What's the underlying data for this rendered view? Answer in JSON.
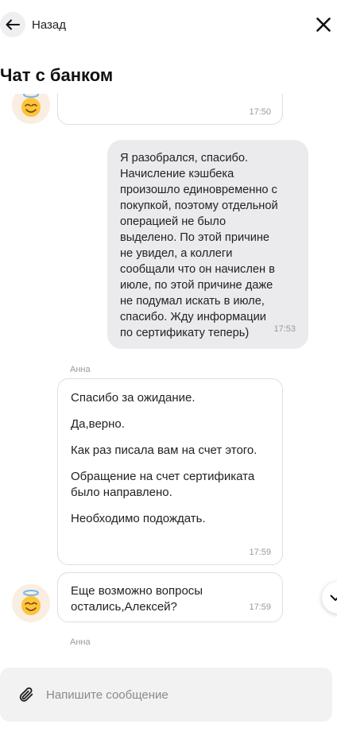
{
  "header": {
    "back_label": "Назад",
    "title": "Чат с банком"
  },
  "messages": [
    {
      "type": "incoming",
      "time": "17:50"
    },
    {
      "type": "outgoing",
      "lines": [
        "Я разобрался, спасибо.",
        "Начисление кэшбека",
        "произошло единовременно с",
        "покупкой, поэтому отдельной",
        "операцией не было",
        "выделено. По этой причине",
        "не увидел, а коллеги",
        "сообщали что он начислен в",
        "июле, по этой причине даже",
        "не подумал искать в июле,",
        "спасибо. Жду информации",
        "по сертификату теперь)"
      ],
      "time": "17:53"
    },
    {
      "type": "incoming",
      "sender": "Анна",
      "paragraphs": [
        "Спасибо за ожидание.",
        "Да,верно.",
        "Как раз писала вам на счет этого.",
        "Обращение на счет сертификата",
        "было направлено.",
        "Необходимо подождать."
      ],
      "time": "17:59"
    },
    {
      "type": "incoming",
      "lines": [
        "Еще возможно вопросы",
        "остались,Алексей?"
      ],
      "time": "17:59"
    },
    {
      "type": "typing",
      "sender": "Анна"
    }
  ],
  "composer": {
    "placeholder": "Напишите сообщение",
    "value": ""
  },
  "colors": {
    "outgoing_bubble": "#ebebed",
    "incoming_border": "#dedede",
    "avatar_bg": "#faeee2",
    "composer_bg": "#f2f2f3"
  },
  "icons": [
    "arrow-left-icon",
    "close-icon",
    "angel-emoji-icon",
    "chevron-down-icon",
    "paperclip-icon"
  ]
}
